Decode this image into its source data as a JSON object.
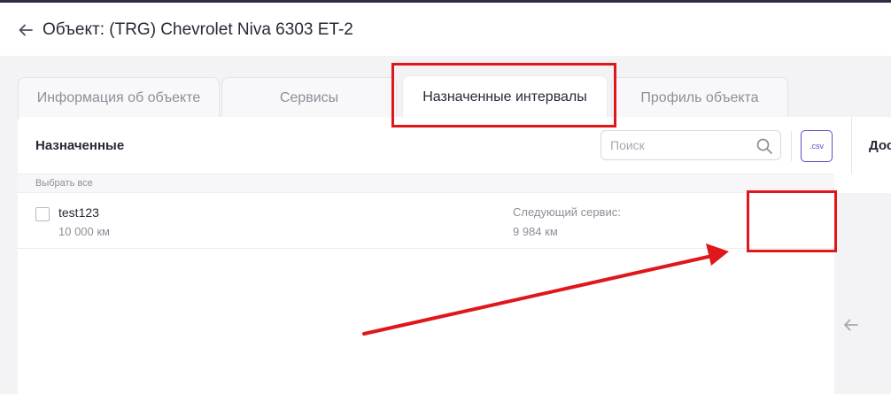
{
  "header": {
    "title": "Объект: (TRG) Chevrolet Niva 6303 ET-2",
    "back_icon": "arrow-left-icon"
  },
  "tabs": [
    {
      "label": "Информация об объекте",
      "active": false
    },
    {
      "label": "Сервисы",
      "active": false
    },
    {
      "label": "Назначенные интервалы",
      "active": true
    },
    {
      "label": "Профиль объекта",
      "active": false
    }
  ],
  "panel": {
    "title": "Назначенные",
    "search": {
      "placeholder": "Поиск",
      "value": ""
    },
    "csv_label": ".csv",
    "right_label": "Дос",
    "select_all": "Выбрать все",
    "items": [
      {
        "name": "test123",
        "interval": "10 000 км",
        "next_service_label": "Следующий сервис:",
        "next_service_value": "9 984 км",
        "checked": false
      }
    ]
  },
  "colors": {
    "accent": "#5c4fc4",
    "annotation_red": "#e0171a",
    "top_bar": "#2f2a45",
    "background": "#f3f3f6"
  }
}
